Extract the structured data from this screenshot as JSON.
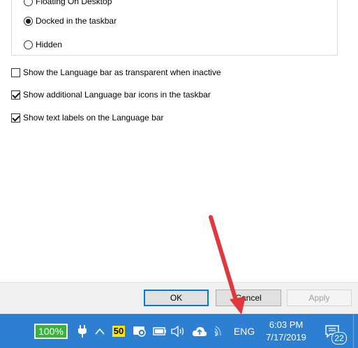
{
  "dialog": {
    "radio_options": [
      {
        "label": "Floating On Desktop",
        "checked": false
      },
      {
        "label": "Docked in the taskbar",
        "checked": true
      },
      {
        "label": "Hidden",
        "checked": false
      }
    ],
    "checkboxes": [
      {
        "label": "Show the Language bar as transparent when inactive",
        "checked": false
      },
      {
        "label": "Show additional Language bar icons in the taskbar",
        "checked": true
      },
      {
        "label": "Show text labels on the Language bar",
        "checked": true
      }
    ],
    "buttons": {
      "ok": "OK",
      "cancel": "Cancel",
      "apply": "Apply"
    }
  },
  "taskbar": {
    "battery_percent": "100%",
    "badge_value": "50",
    "language": "ENG",
    "time": "6:03 PM",
    "date": "7/17/2019",
    "notifications_count": "22",
    "accent_color": "#2d7fd2"
  },
  "annotation": {
    "arrow_color": "#e0383e"
  }
}
